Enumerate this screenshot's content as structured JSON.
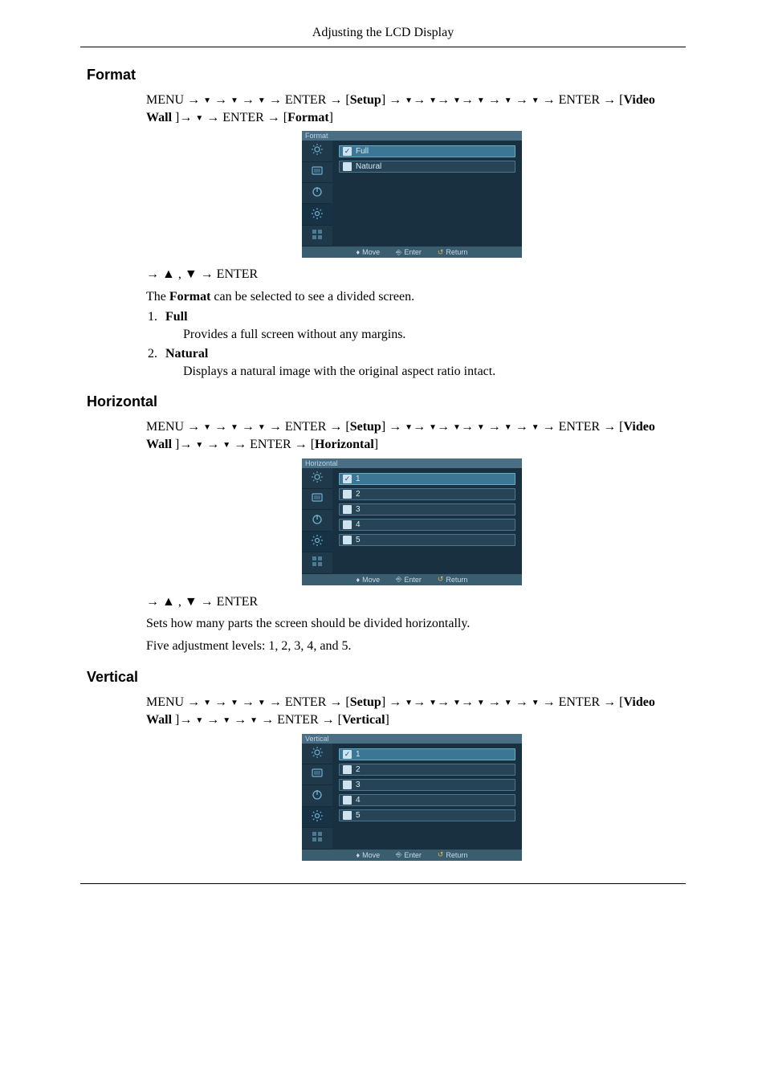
{
  "page_header": "Adjusting the LCD Display",
  "glyphs": {
    "arrow": "→",
    "down": "▼",
    "up": "▲"
  },
  "nav_tokens": {
    "menu": "MENU",
    "enter": "ENTER",
    "setup": "Setup",
    "video_wall": "Video Wall"
  },
  "sections": {
    "format": {
      "heading": "Format",
      "nav_tail_key": "Format",
      "post_img_nav": "→ ▲ , ▼ → ENTER",
      "intro_pre": "The ",
      "intro_bold": "Format",
      "intro_post": " can be selected to see a divided screen.",
      "items": [
        {
          "head": "Full",
          "desc": "Provides a full screen without any margins."
        },
        {
          "head": "Natural",
          "desc": "Displays a natural image with the original aspect ratio intact."
        }
      ],
      "osd": {
        "title": "Format",
        "options": [
          {
            "label": "Full",
            "selected": true
          },
          {
            "label": "Natural",
            "selected": false
          }
        ],
        "footer": {
          "move": "Move",
          "enter": "Enter",
          "return": "Return"
        }
      }
    },
    "horizontal": {
      "heading": "Horizontal",
      "nav_tail_key": "Horizontal",
      "nav_extra_downs": 1,
      "post_img_nav": "→ ▲ , ▼ → ENTER",
      "lines": [
        "Sets how many parts the screen should be divided horizontally.",
        "Five adjustment levels: 1, 2, 3, 4, and 5."
      ],
      "osd": {
        "title": "Horizontal",
        "options": [
          {
            "label": "1",
            "selected": true
          },
          {
            "label": "2",
            "selected": false
          },
          {
            "label": "3",
            "selected": false
          },
          {
            "label": "4",
            "selected": false
          },
          {
            "label": "5",
            "selected": false
          }
        ],
        "footer": {
          "move": "Move",
          "enter": "Enter",
          "return": "Return"
        }
      }
    },
    "vertical": {
      "heading": "Vertical",
      "nav_tail_key": "Vertical",
      "nav_extra_downs": 2,
      "osd": {
        "title": "Vertical",
        "options": [
          {
            "label": "1",
            "selected": true
          },
          {
            "label": "2",
            "selected": false
          },
          {
            "label": "3",
            "selected": false
          },
          {
            "label": "4",
            "selected": false
          },
          {
            "label": "5",
            "selected": false
          }
        ],
        "footer": {
          "move": "Move",
          "enter": "Enter",
          "return": "Return"
        }
      }
    }
  }
}
